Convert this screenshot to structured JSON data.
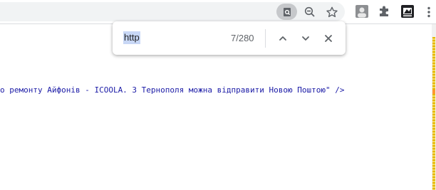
{
  "toolbar": {
    "icons": [
      "find-in-page-icon",
      "zoom-icon",
      "star-icon",
      "extension-avatar-icon",
      "puzzle-icon",
      "extension-dark-icon",
      "kebab-menu-icon"
    ]
  },
  "find_bar": {
    "query": "http",
    "count": "7/280"
  },
  "source": {
    "line": "о ремонту Айфонів - ICOOLA. З Тернополя можна відправити Новою Поштою\" />"
  },
  "colors": {
    "highlight": "#c8d7f5",
    "code_text": "#1a1aa6",
    "scroll_match": "#e6b800"
  }
}
